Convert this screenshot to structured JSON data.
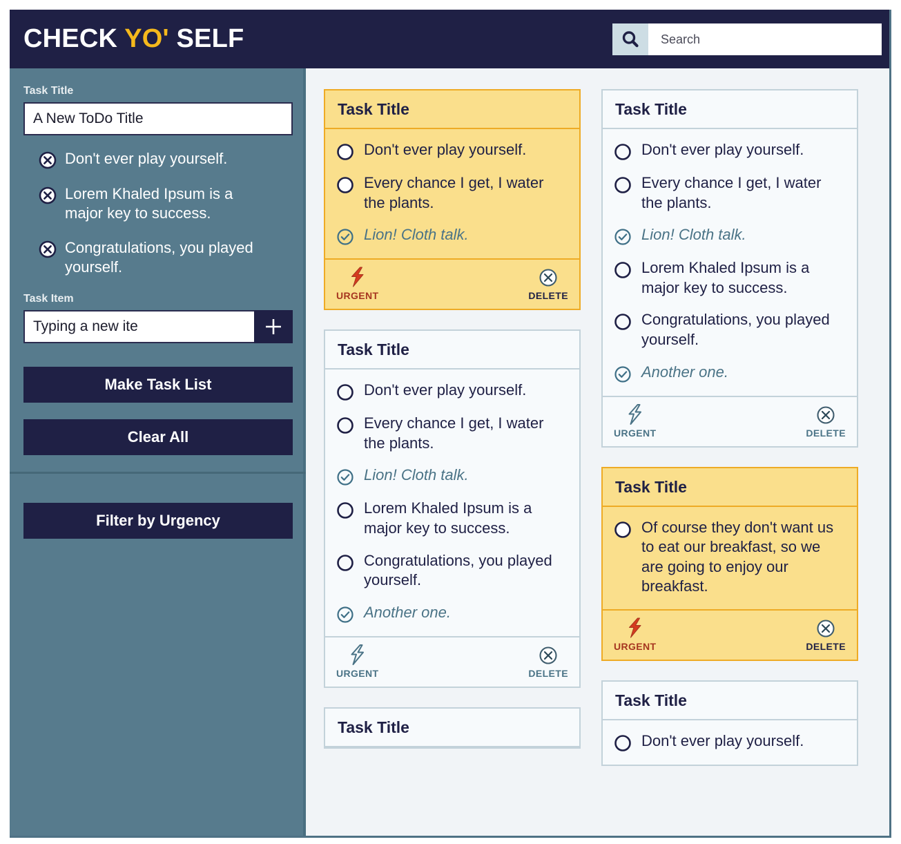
{
  "header": {
    "brand_part1": "CHECK ",
    "brand_accent": "YO'",
    "brand_part2": " SELF",
    "search_placeholder": "Search",
    "search_value": "",
    "search_icon": "search-icon"
  },
  "sidebar": {
    "task_title_label": "Task Title",
    "task_title_value": "A New ToDo Title",
    "task_title_placeholder": "Task Title",
    "draft_items": [
      "Don't ever play yourself.",
      "Lorem Khaled Ipsum is a major key to success.",
      "Congratulations, you played yourself."
    ],
    "task_item_label": "Task Item",
    "task_item_value": "Typing a new ite",
    "task_item_placeholder": "Task Item",
    "add_button_label": "+",
    "make_list_label": "Make Task List",
    "clear_all_label": "Clear All",
    "filter_label": "Filter by Urgency"
  },
  "board": {
    "footer_urgent_label": "URGENT",
    "footer_delete_label": "DELETE",
    "columns": [
      {
        "cards": [
          {
            "title": "Task Title",
            "urgent": true,
            "items": [
              {
                "text": "Don't ever play yourself.",
                "done": false
              },
              {
                "text": "Every chance I get, I water the plants.",
                "done": false
              },
              {
                "text": "Lion! Cloth talk.",
                "done": true
              }
            ]
          },
          {
            "title": "Task Title",
            "urgent": false,
            "items": [
              {
                "text": "Don't ever play yourself.",
                "done": false
              },
              {
                "text": "Every chance I get, I water the plants.",
                "done": false
              },
              {
                "text": "Lion! Cloth talk.",
                "done": true
              },
              {
                "text": "Lorem Khaled Ipsum is a major key to success.",
                "done": false
              },
              {
                "text": "Congratulations, you played yourself.",
                "done": false
              },
              {
                "text": "Another one.",
                "done": true
              }
            ]
          },
          {
            "title": "Task Title",
            "urgent": false,
            "clipped": true,
            "items": []
          }
        ]
      },
      {
        "cards": [
          {
            "title": "Task Title",
            "urgent": false,
            "items": [
              {
                "text": "Don't ever play yourself.",
                "done": false
              },
              {
                "text": "Every chance I get, I water the plants.",
                "done": false
              },
              {
                "text": "Lion! Cloth talk.",
                "done": true
              },
              {
                "text": "Lorem Khaled Ipsum is a major key to success.",
                "done": false
              },
              {
                "text": "Congratulations, you played yourself.",
                "done": false
              },
              {
                "text": "Another one.",
                "done": true
              }
            ]
          },
          {
            "title": "Task Title",
            "urgent": true,
            "items": [
              {
                "text": "Of course they don't want us to eat our breakfast, so we are going to enjoy our breakfast.",
                "done": false
              }
            ]
          },
          {
            "title": "Task Title",
            "urgent": false,
            "clipped": true,
            "items": [
              {
                "text": "Don't ever play yourself.",
                "done": false
              }
            ]
          }
        ]
      }
    ]
  },
  "colors": {
    "header_bg": "#1f2045",
    "accent_gold": "#f5b91c",
    "sidebar_bg": "#577b8d",
    "board_bg": "#f1f4f7",
    "urgent_card_bg": "#fadf8c",
    "urgent_card_border": "#eeab25",
    "card_bg": "#f7fafc",
    "card_border": "#c3d2da",
    "urgent_red": "#d63b1e",
    "done_text": "#4a7386"
  }
}
